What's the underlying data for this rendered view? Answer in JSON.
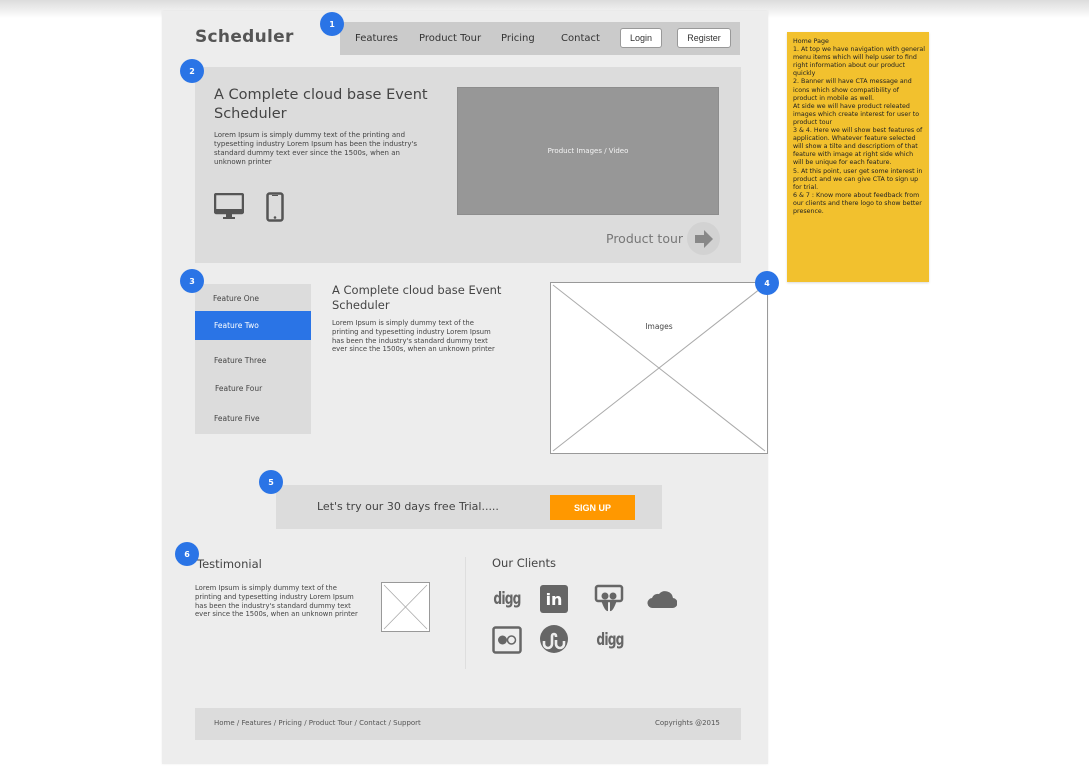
{
  "header": {
    "logo": "Scheduler",
    "nav_items": [
      "Features",
      "Product Tour",
      "Pricing",
      "Contact"
    ],
    "login_label": "Login",
    "register_label": "Register"
  },
  "badges": [
    "1",
    "2",
    "3",
    "4",
    "5",
    "6"
  ],
  "banner": {
    "title": "A Complete cloud base Event Scheduler",
    "description": "Lorem Ipsum is simply dummy text of the printing and typesetting industry Lorem Ipsum has been the industry's standard dummy text ever since the 1500s, when an unknown printer",
    "media_label": "Product Images / Video",
    "product_tour_label": "Product tour",
    "icons": [
      "desktop-icon",
      "mobile-phone-icon"
    ]
  },
  "features": {
    "items": [
      "Feature One",
      "Feature Two",
      "Feature Three",
      "Feature Four",
      "Feature Five"
    ],
    "active_index": 1,
    "title": "A Complete cloud base Event Scheduler",
    "description": "Lorem Ipsum is simply dummy text of the printing and typesetting industry Lorem Ipsum has been the industry's standard dummy text ever since the 1500s, when an unknown printer",
    "image_label": "Images"
  },
  "trial": {
    "text": "Let's try our 30 days free Trial.....",
    "button_label": "SIGN UP",
    "button_color": "#ff9800"
  },
  "testimonial": {
    "title": "Testimonial",
    "description": "Lorem Ipsum is simply dummy text of the printing and typesetting industry Lorem Ipsum has been the industry's standard dummy text ever since the 1500s, when an unknown printer"
  },
  "clients": {
    "title": "Our Clients",
    "logos": [
      "digg",
      "linkedin",
      "slideshare",
      "cloud",
      "flickr",
      "stumbleupon",
      "digg"
    ],
    "digg_text": "digg",
    "linkedin_text": "in"
  },
  "footer": {
    "links": "Home / Features / Pricing / Product Tour / Contact / Support",
    "copyright": "Copyrights @2015"
  },
  "note": {
    "text": "Home Page\n1. At top we have navigation with general menu items which will help user to find right information about our product quickly\n2. Banner will have CTA message and icons which show compatibility of product in mobile as well.\nAt side we will have product releated images which create interest for user to product tour\n3 & 4. Here we will show best features of application. Whatever feature selected will show a tilte and descriptiom of that feature with image at right side which will be unique for each feature.\n5. At this point, user get some interest in product and we can give CTA to sign up for trial.\n6 & 7 : Know more about feedback from our clients and there logo to show better presence."
  },
  "colors": {
    "accent": "#2a74e6",
    "cta": "#ff9800",
    "note": "#f2c12e"
  }
}
